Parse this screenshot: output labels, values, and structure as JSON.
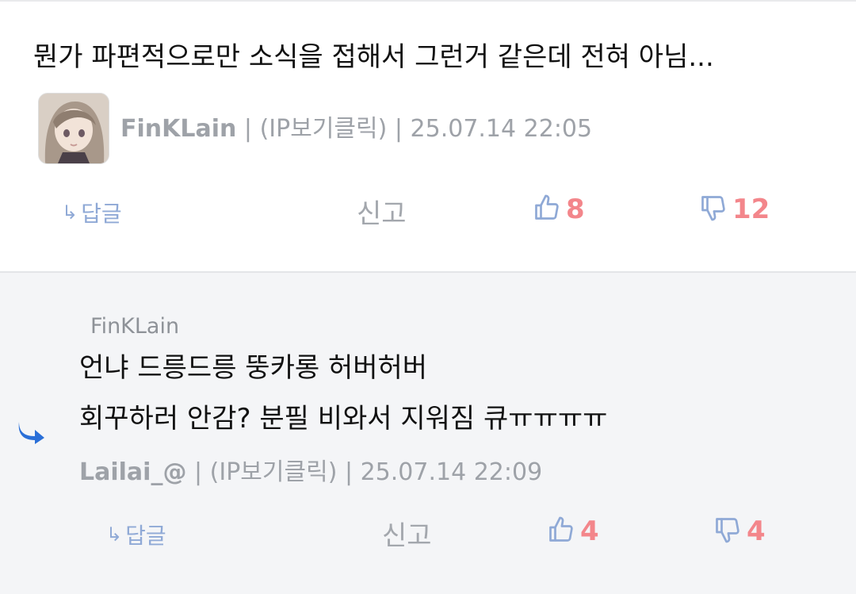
{
  "main_comment": {
    "text": "뭔가 파편적으로만 소식을 접해서 그런거 같은데 전혀 아님...",
    "author": "FinKLain",
    "sep1": " | ",
    "ip": "(IP보기클릭)",
    "sep2": " | ",
    "datetime": "25.07.14 22:05",
    "reply_label": "답글",
    "report_label": "신고",
    "likes": "8",
    "dislikes": "12"
  },
  "reply_comment": {
    "reply_to": "FinKLain",
    "line1": "언냐 드릉드릉 뚱카롱 허버허버",
    "line2": "회꾸하러 안감? 분필 비와서 지워짐 큐ㅠㅠㅠㅠ",
    "author": "Lailai_@",
    "sep1": " | ",
    "ip": "(IP보기클릭)",
    "sep2": " | ",
    "datetime": "25.07.14 22:09",
    "reply_label": "답글",
    "report_label": "신고",
    "likes": "4",
    "dislikes": "4"
  },
  "colors": {
    "accent_blue": "#8fa9d6",
    "count_red": "#f3868b",
    "meta_gray": "#9ea2a8",
    "reply_bg": "#f4f5f7",
    "reply_arrow_blue": "#2a6fd8"
  },
  "icons": {
    "reply": "reply-arrow-icon",
    "like": "thumbs-up-icon",
    "dislike": "thumbs-down-icon",
    "nested_reply": "nested-reply-arrow-icon"
  }
}
